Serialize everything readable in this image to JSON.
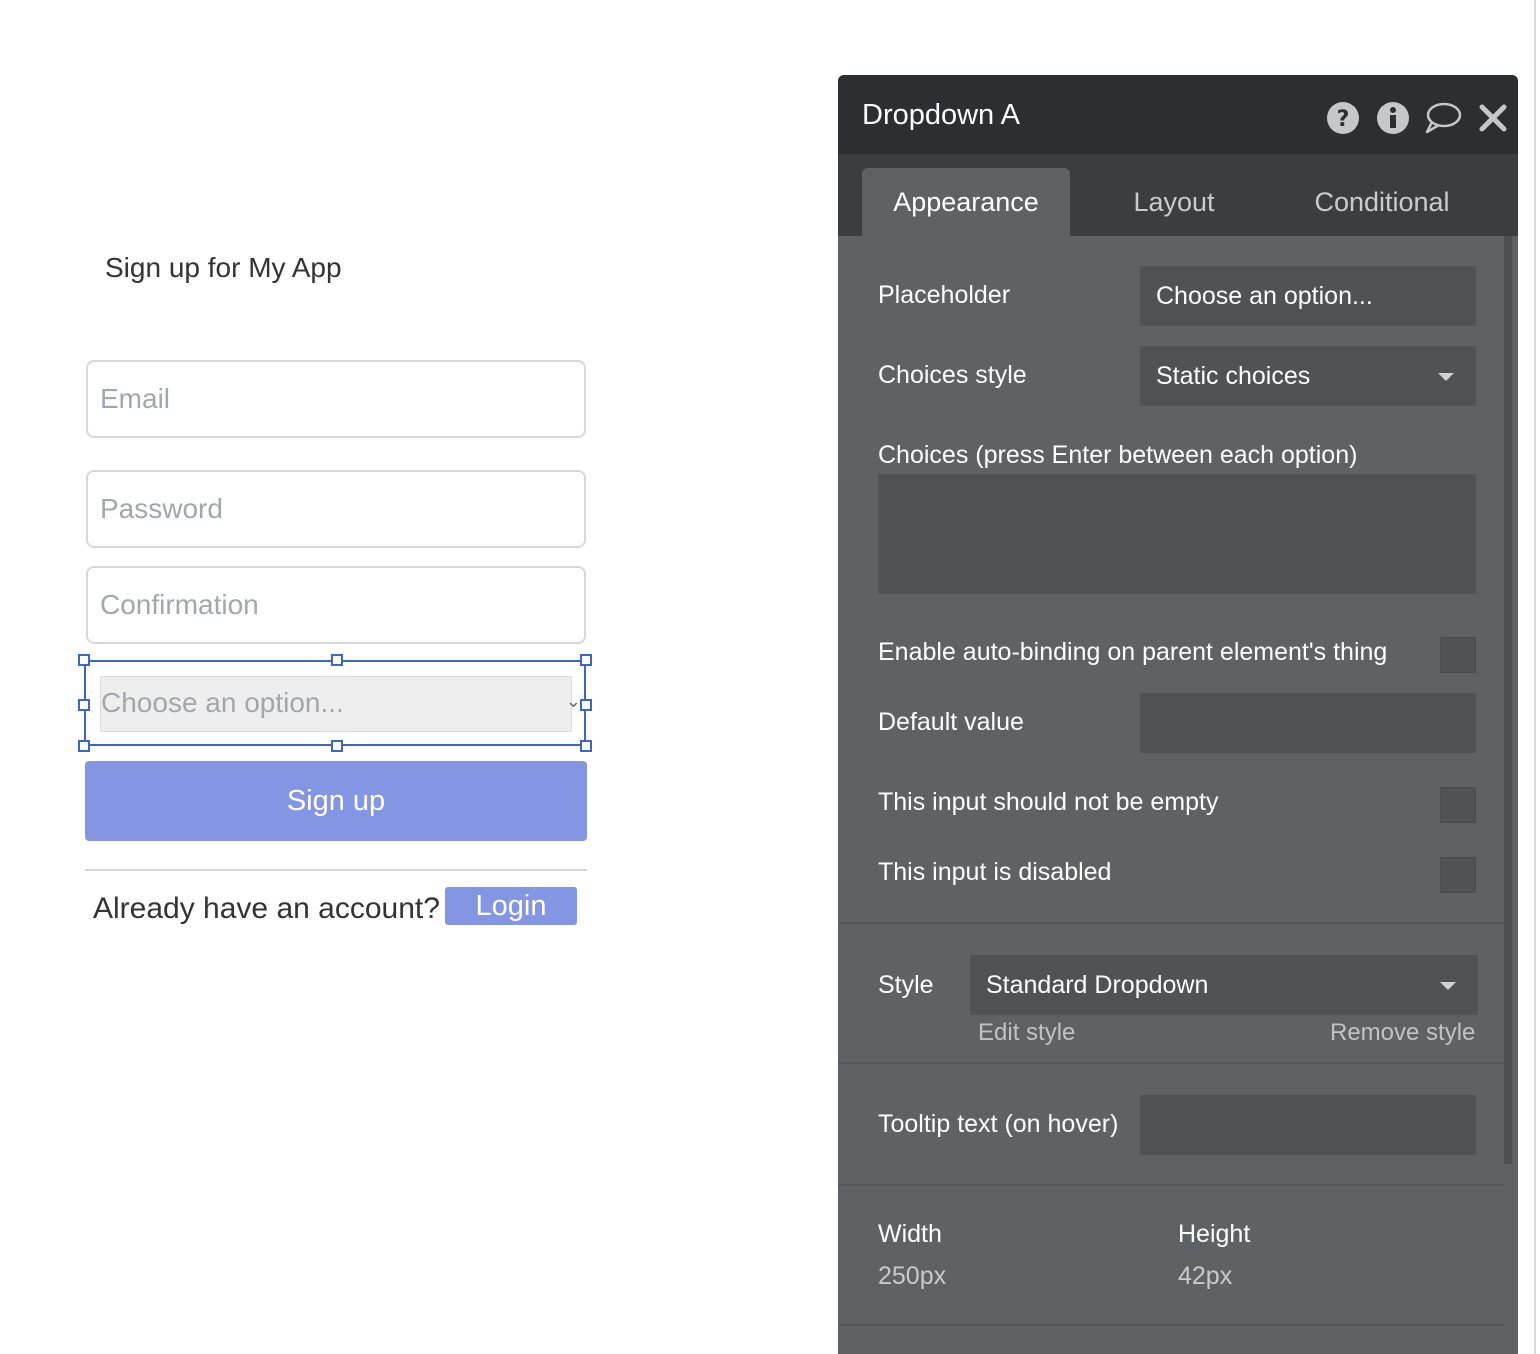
{
  "form": {
    "title": "Sign up for My App",
    "email_placeholder": "Email",
    "password_placeholder": "Password",
    "confirmation_placeholder": "Confirmation",
    "dropdown_placeholder": "Choose an option...",
    "signup_label": "Sign up",
    "already_text": "Already have an account?",
    "login_label": "Login"
  },
  "panel": {
    "title": "Dropdown A",
    "icons": [
      "help-icon",
      "info-icon",
      "comment-icon",
      "close-icon"
    ],
    "tabs": [
      {
        "label": "Appearance",
        "active": true
      },
      {
        "label": "Layout",
        "active": false
      },
      {
        "label": "Conditional",
        "active": false
      }
    ],
    "placeholder_label": "Placeholder",
    "placeholder_value": "Choose an option...",
    "choices_style_label": "Choices style",
    "choices_style_value": "Static choices",
    "choices_label": "Choices (press Enter between each option)",
    "choices_value": "",
    "autobinding_label": "Enable auto-binding on parent element's thing",
    "default_value_label": "Default value",
    "default_value": "",
    "not_empty_label": "This input should not be empty",
    "disabled_label": "This input is disabled",
    "style_label": "Style",
    "style_value": "Standard Dropdown",
    "edit_style": "Edit style",
    "remove_style": "Remove style",
    "tooltip_label": "Tooltip text (on hover)",
    "tooltip_value": "",
    "width_label": "Width",
    "width_value": "250px",
    "height_label": "Height",
    "height_value": "42px"
  },
  "colors": {
    "panel_bg": "#5e6265",
    "panel_header": "#2b2f31",
    "button_accent": "#8496e3",
    "selection_handle": "#3a67c8"
  }
}
